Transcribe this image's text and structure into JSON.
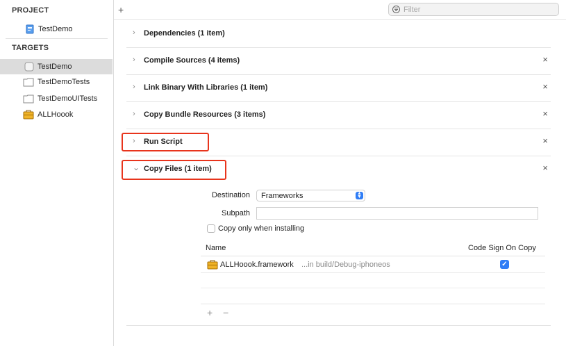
{
  "sidebar": {
    "project_header": "PROJECT",
    "project_item": {
      "label": "TestDemo",
      "icon": "project-file-icon"
    },
    "targets_header": "TARGETS",
    "targets": [
      {
        "label": "TestDemo",
        "icon": "target-app-icon",
        "selected": true
      },
      {
        "label": "TestDemoTests",
        "icon": "target-folder-icon",
        "selected": false
      },
      {
        "label": "TestDemoUITests",
        "icon": "target-folder-icon",
        "selected": false
      },
      {
        "label": "ALLHoook",
        "icon": "toolbox-icon",
        "selected": false
      }
    ]
  },
  "toolbar": {
    "add_label": "+",
    "filter_placeholder": "Filter"
  },
  "phases": [
    {
      "title": "Dependencies (1 item)",
      "expanded": false,
      "removable": false
    },
    {
      "title": "Compile Sources (4 items)",
      "expanded": false,
      "removable": true
    },
    {
      "title": "Link Binary With Libraries (1 item)",
      "expanded": false,
      "removable": true
    },
    {
      "title": "Copy Bundle Resources (3 items)",
      "expanded": false,
      "removable": true
    },
    {
      "title": "Run Script",
      "expanded": false,
      "removable": true,
      "highlighted": true
    },
    {
      "title": "Copy Files (1 item)",
      "expanded": true,
      "removable": true,
      "highlighted": true
    }
  ],
  "icons": {
    "chevron_collapsed": "›",
    "chevron_expanded": "⌄",
    "remove": "×"
  },
  "copy_files": {
    "destination_label": "Destination",
    "destination_value": "Frameworks",
    "subpath_label": "Subpath",
    "subpath_value": "",
    "copy_only_label": "Copy only when installing",
    "copy_only_checked": false,
    "table": {
      "col_name": "Name",
      "col_codesign": "Code Sign On Copy",
      "rows": [
        {
          "name": "ALLHoook.framework",
          "location": "...in build/Debug-iphoneos",
          "code_sign": true
        }
      ]
    },
    "add_label": "+",
    "remove_label": "−"
  },
  "colors": {
    "accent": "#2f7df6",
    "highlight_border": "#e8341c",
    "selection": "#dcdcdc"
  }
}
